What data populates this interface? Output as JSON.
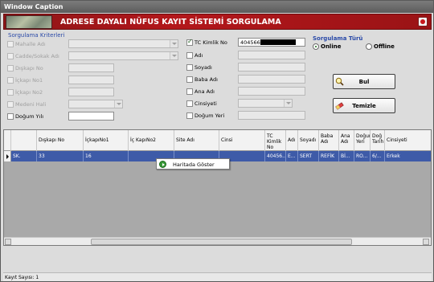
{
  "window": {
    "title": "Window Caption"
  },
  "header": {
    "title": "ADRESE DAYALI NÜFUS KAYIT SİSTEMİ SORGULAMA"
  },
  "criteria": {
    "group_title": "Sorgulama Kriterleri",
    "mahalle": "Mahalle Adı",
    "cadde": "Cadde/Sokak Adı",
    "diskapi": "Dışkapı No",
    "ickapi1": "İçkapı No1",
    "ickapi2": "İçkapı No2",
    "medeni": "Medeni Hali",
    "dogum_yili": "Doğum Yılı",
    "tc": "TC Kimlik No",
    "tc_value": "404566",
    "adi": "Adı",
    "soyadi": "Soyadı",
    "baba": "Baba Adı",
    "ana": "Ana  Adı",
    "cinsiyeti": "Cinsiyeti",
    "dogum_yeri": "Doğum Yeri"
  },
  "query_type": {
    "title": "Sorgulama Türü",
    "online": "Online",
    "offline": "Offline"
  },
  "buttons": {
    "search": "Bul",
    "clear": "Temizle"
  },
  "grid": {
    "columns": [
      "",
      "Dışkapı No",
      "İçkapıNo1",
      "İç KapıNo2",
      "Site Adı",
      "Cinsi",
      "TC Kimlik No",
      "Adı",
      "Soyadı",
      "Baba Adı",
      "Ana Adı",
      "Doğum Yeri",
      "Doğ Tarih",
      "Cinsiyeti"
    ],
    "rows": [
      [
        "SK.",
        "33",
        "16",
        "",
        "",
        "",
        "40456...",
        "E...",
        "SERT",
        "REFİK",
        "Bİ...",
        "RO...",
        "6/...",
        "Erkek"
      ]
    ]
  },
  "context_menu": {
    "item": "Haritada Göster"
  },
  "status": {
    "text": "Kayıt Sayısı: 1"
  },
  "colors": {
    "header": "#b3171b",
    "selected_row": "#3e5ba8",
    "group_title": "#2a4aa8"
  }
}
